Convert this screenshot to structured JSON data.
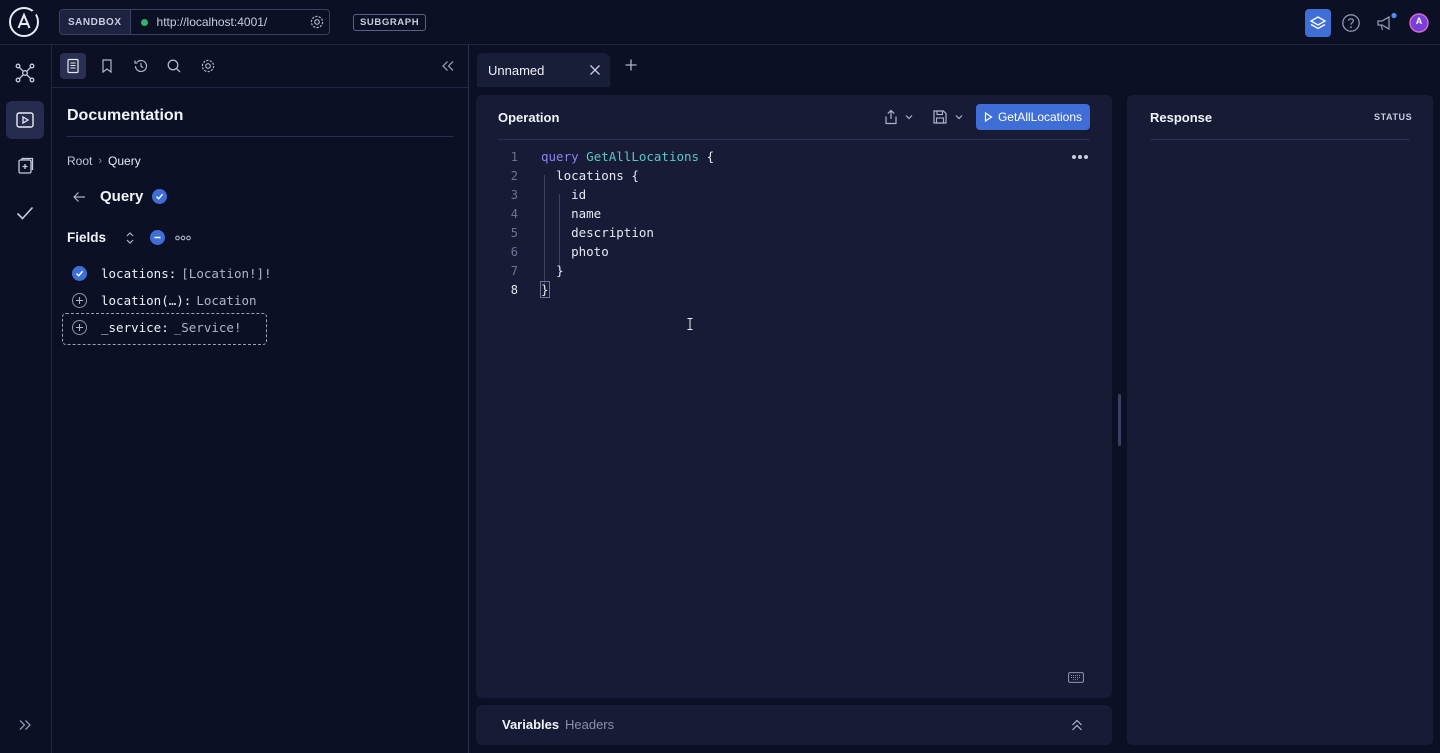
{
  "topbar": {
    "sandbox_label": "SANDBOX",
    "endpoint_url": "http://localhost:4001/",
    "subgraph_label": "SUBGRAPH",
    "avatar_initials": "A"
  },
  "docs": {
    "title": "Documentation",
    "breadcrumb": [
      "Root",
      "Query"
    ],
    "type_name": "Query",
    "fields_label": "Fields",
    "fields": [
      {
        "name": "locations:",
        "type": "[Location!]!",
        "selected": true
      },
      {
        "name": "location(…):",
        "type": "Location",
        "selected": false
      },
      {
        "name": "_service:",
        "type": "_Service!",
        "selected": false
      }
    ]
  },
  "tabs": [
    {
      "label": "Unnamed"
    }
  ],
  "operation": {
    "title": "Operation",
    "run_label": "GetAllLocations",
    "lines": [
      {
        "num": "1",
        "indent": "",
        "keyword": "query",
        "name": "GetAllLocations",
        "text": " {"
      },
      {
        "num": "2",
        "indent": "  ",
        "keyword": "",
        "name": "",
        "text": "locations {"
      },
      {
        "num": "3",
        "indent": "    ",
        "keyword": "",
        "name": "",
        "text": "id"
      },
      {
        "num": "4",
        "indent": "    ",
        "keyword": "",
        "name": "",
        "text": "name"
      },
      {
        "num": "5",
        "indent": "    ",
        "keyword": "",
        "name": "",
        "text": "description"
      },
      {
        "num": "6",
        "indent": "    ",
        "keyword": "",
        "name": "",
        "text": "photo"
      },
      {
        "num": "7",
        "indent": "  ",
        "keyword": "",
        "name": "",
        "text": "}"
      },
      {
        "num": "8",
        "indent": "",
        "keyword": "",
        "name": "",
        "text": "}"
      }
    ]
  },
  "variables": {
    "title": "Variables",
    "headers_label": "Headers"
  },
  "response": {
    "title": "Response",
    "status_label": "STATUS"
  },
  "colors": {
    "accent": "#3f6fd6",
    "keyword": "#8f83f0",
    "operation_name": "#5bc6c5",
    "status_ok": "#2fb36b"
  }
}
